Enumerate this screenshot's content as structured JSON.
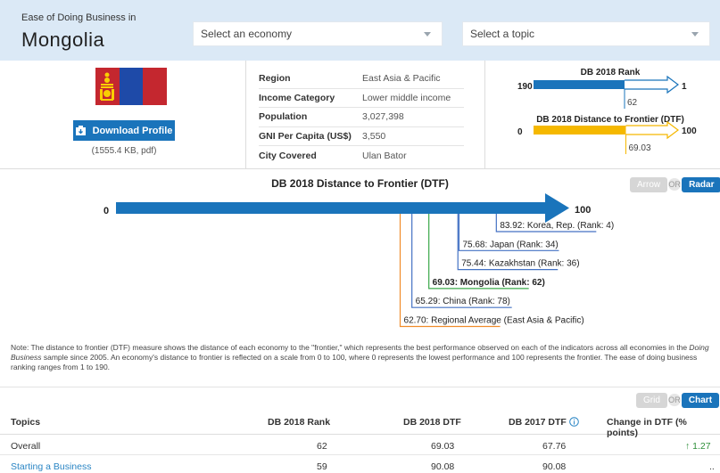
{
  "header": {
    "label": "Ease of Doing Business in",
    "country": "Mongolia",
    "economy_select": "Select an economy",
    "topic_select": "Select a topic"
  },
  "profile": {
    "download_label": "Download Profile",
    "file_size": "(1555.4 KB, pdf)"
  },
  "info": {
    "rows": [
      {
        "key": "Region",
        "value": "East Asia & Pacific"
      },
      {
        "key": "Income Category",
        "value": "Lower middle income"
      },
      {
        "key": "Population",
        "value": "3,027,398"
      },
      {
        "key": "GNI Per Capita (US$)",
        "value": "3,550"
      },
      {
        "key": "City Covered",
        "value": "Ulan Bator"
      }
    ]
  },
  "mini": {
    "rank_title": "DB 2018 Rank",
    "rank_left": "190",
    "rank_right": "1",
    "rank_value": "62",
    "dtf_title": "DB 2018 Distance to Frontier (DTF)",
    "dtf_left": "0",
    "dtf_right": "100",
    "dtf_value": "69.03",
    "rank_fraction": 0.68,
    "dtf_fraction": 0.69,
    "rank_color": "#1a74bb",
    "dtf_color": "#f5b800"
  },
  "dtf_chart": {
    "title": "DB 2018 Distance to Frontier (DTF)",
    "min_label": "0",
    "max_label": "100",
    "toggle_off": "Arrow",
    "toggle_or": "OR",
    "toggle_on": "Radar",
    "markers": [
      {
        "value": 83.92,
        "label": "83.92: Korea, Rep. (Rank: 4)",
        "color": "#4472c4",
        "bold": false
      },
      {
        "value": 75.68,
        "label": "75.68: Japan (Rank: 34)",
        "color": "#4472c4",
        "bold": false
      },
      {
        "value": 75.44,
        "label": "75.44: Kazakhstan (Rank: 36)",
        "color": "#4472c4",
        "bold": false
      },
      {
        "value": 69.03,
        "label": "69.03: Mongolia (Rank: 62)",
        "color": "#3aa84a",
        "bold": true
      },
      {
        "value": 65.29,
        "label": "65.29: China (Rank: 78)",
        "color": "#4472c4",
        "bold": false
      },
      {
        "value": 62.7,
        "label": "62.70: Regional Average (East Asia & Pacific)",
        "color": "#f08c2a",
        "bold": false
      }
    ]
  },
  "note": {
    "before_italic": "Note: The distance to frontier (DTF) measure shows the distance of each economy to the \"frontier,\" which represents the best performance observed on each of the indicators across all economies in the ",
    "italic": "Doing Business",
    "after_italic": " sample since 2005. An economy's distance to frontier is reflected on a scale from 0 to 100, where 0 represents the lowest performance and 100 represents the frontier. The ease of doing business ranking ranges from 1 to 190."
  },
  "table": {
    "toggle_off": "Grid",
    "toggle_or": "OR",
    "toggle_on": "Chart",
    "headers": {
      "topics": "Topics",
      "rank": "DB 2018 Rank",
      "dtf": "DB 2018 DTF",
      "dtf2017": "DB 2017 DTF",
      "change": "Change in DTF (% points)"
    },
    "rows": [
      {
        "topic": "Overall",
        "rank": "62",
        "dtf": "69.03",
        "dtf2017": "67.76",
        "change": "1.27",
        "arrow": "↑"
      },
      {
        "topic": "Starting a Business",
        "rank": "59",
        "dtf": "90.08",
        "dtf2017": "90.08",
        "change": "..",
        "arrow": ""
      }
    ]
  }
}
